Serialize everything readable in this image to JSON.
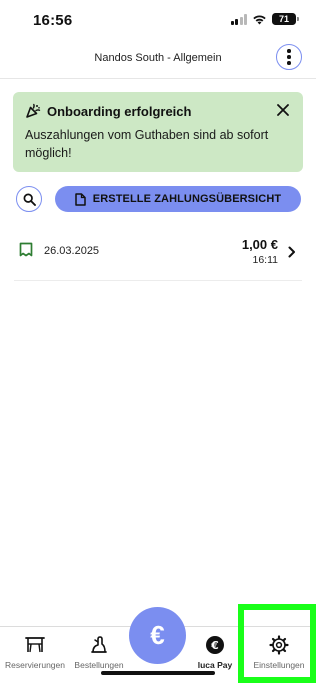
{
  "status_bar": {
    "time": "16:56",
    "battery": "71"
  },
  "header": {
    "title": "Nandos South - Allgemein"
  },
  "banner": {
    "title": "Onboarding erfolgreich",
    "text": "Auszahlungen vom Guthaben sind ab sofort möglich!",
    "background": "#cde8c5"
  },
  "actions": {
    "overview_label": "ERSTELLE ZAHLUNGSÜBERSICHT"
  },
  "transactions": [
    {
      "date": "26.03.2025",
      "amount": "1,00 €",
      "time": "16:11"
    }
  ],
  "tabbar": {
    "tabs": [
      {
        "label": "Reservierungen",
        "icon": "table-icon"
      },
      {
        "label": "Bestellungen",
        "icon": "waiter-icon"
      },
      {
        "label": "luca Pay",
        "icon": "euro-coin-icon"
      },
      {
        "label": "Einstellungen",
        "icon": "gear-icon"
      }
    ],
    "fab_symbol": "€"
  },
  "colors": {
    "accent": "#7b8ef0",
    "success_bg": "#cde8c5",
    "highlight": "#19ff19",
    "receipt_icon": "#2e7d32"
  }
}
